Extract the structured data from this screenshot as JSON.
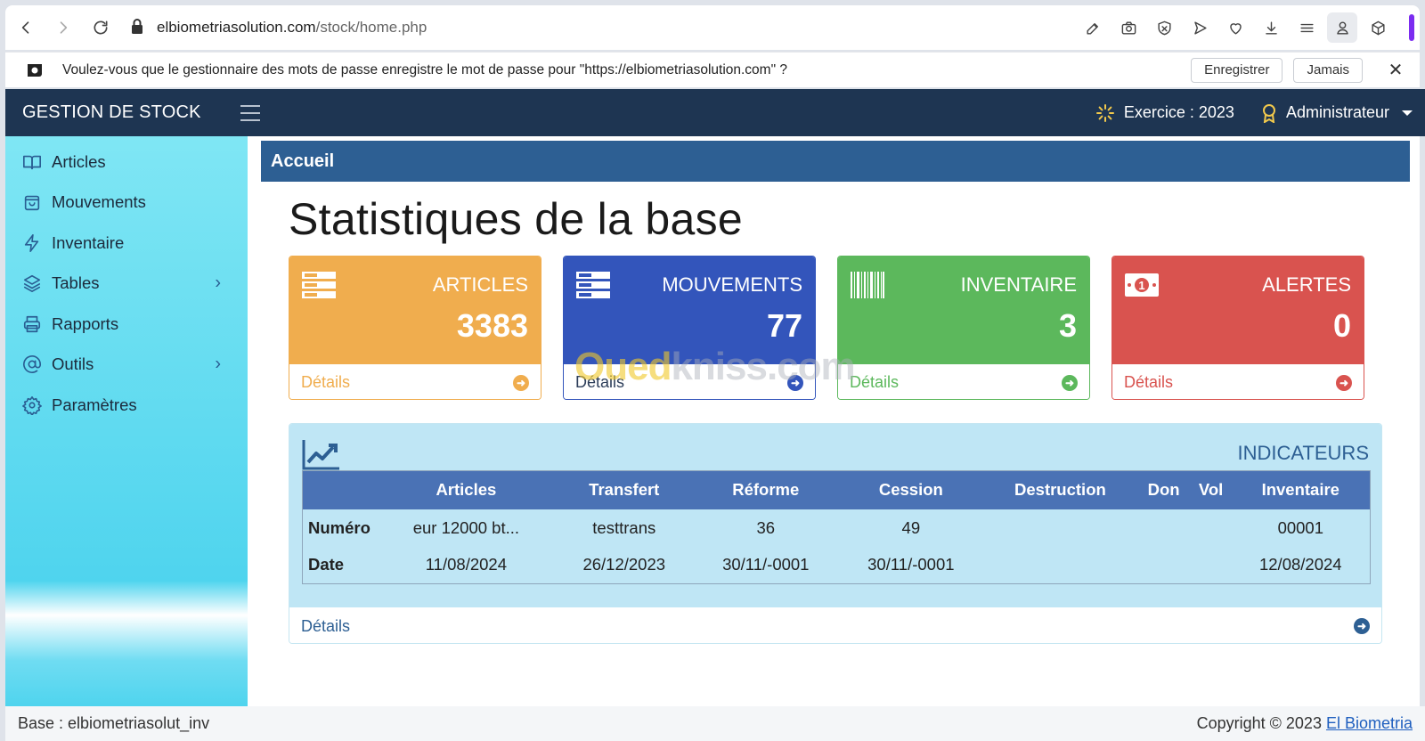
{
  "browser": {
    "url_host": "elbiometriasolution.com",
    "url_path": "/stock/home.php"
  },
  "password_prompt": {
    "message": "Voulez-vous que le gestionnaire des mots de passe enregistre le mot de passe pour \"https://elbiometriasolution.com\" ?",
    "save_label": "Enregistrer",
    "never_label": "Jamais",
    "close_label": "✕"
  },
  "header": {
    "brand": "GESTION DE STOCK",
    "exercise": "Exercice : 2023",
    "user": "Administrateur"
  },
  "sidebar": {
    "items": [
      {
        "label": "Articles",
        "icon": "book-icon"
      },
      {
        "label": "Mouvements",
        "icon": "shopping-bag-icon"
      },
      {
        "label": "Inventaire",
        "icon": "lightning-icon"
      },
      {
        "label": "Tables",
        "icon": "layers-icon",
        "chevron": "›"
      },
      {
        "label": "Rapports",
        "icon": "printer-icon"
      },
      {
        "label": "Outils",
        "icon": "at-icon",
        "chevron": "›"
      },
      {
        "label": "Paramètres",
        "icon": "gear-icon"
      }
    ]
  },
  "main": {
    "breadcrumb": "Accueil",
    "title": "Statistiques de la base",
    "cards": [
      {
        "title": "ARTICLES",
        "value": "3383",
        "details": "Détails",
        "color": "#f0ad4e"
      },
      {
        "title": "MOUVEMENTS",
        "value": "77",
        "details": "Détails",
        "color": "#3355bb"
      },
      {
        "title": "INVENTAIRE",
        "value": "3",
        "details": "Détails",
        "color": "#5cb85c"
      },
      {
        "title": "ALERTES",
        "value": "0",
        "details": "Détails",
        "color": "#d9534f"
      }
    ],
    "watermark": {
      "prefix": "Oued",
      "suffix": "kniss.com"
    },
    "indicators": {
      "title": "INDICATEURS",
      "columns": [
        "",
        "Articles",
        "Transfert",
        "Réforme",
        "Cession",
        "Destruction",
        "Don",
        "Vol",
        "Inventaire"
      ],
      "rows": [
        [
          "Numéro",
          "eur 12000 bt...",
          "testtrans",
          "36",
          "49",
          "",
          "",
          "",
          "00001"
        ],
        [
          "Date",
          "11/08/2024",
          "26/12/2023",
          "30/11/-0001",
          "30/11/-0001",
          "",
          "",
          "",
          "12/08/2024"
        ]
      ],
      "details": "Détails"
    }
  },
  "footer": {
    "base": "Base : elbiometriasolut_inv",
    "copyright": "Copyright © 2023 ",
    "link": "El Biometria"
  }
}
